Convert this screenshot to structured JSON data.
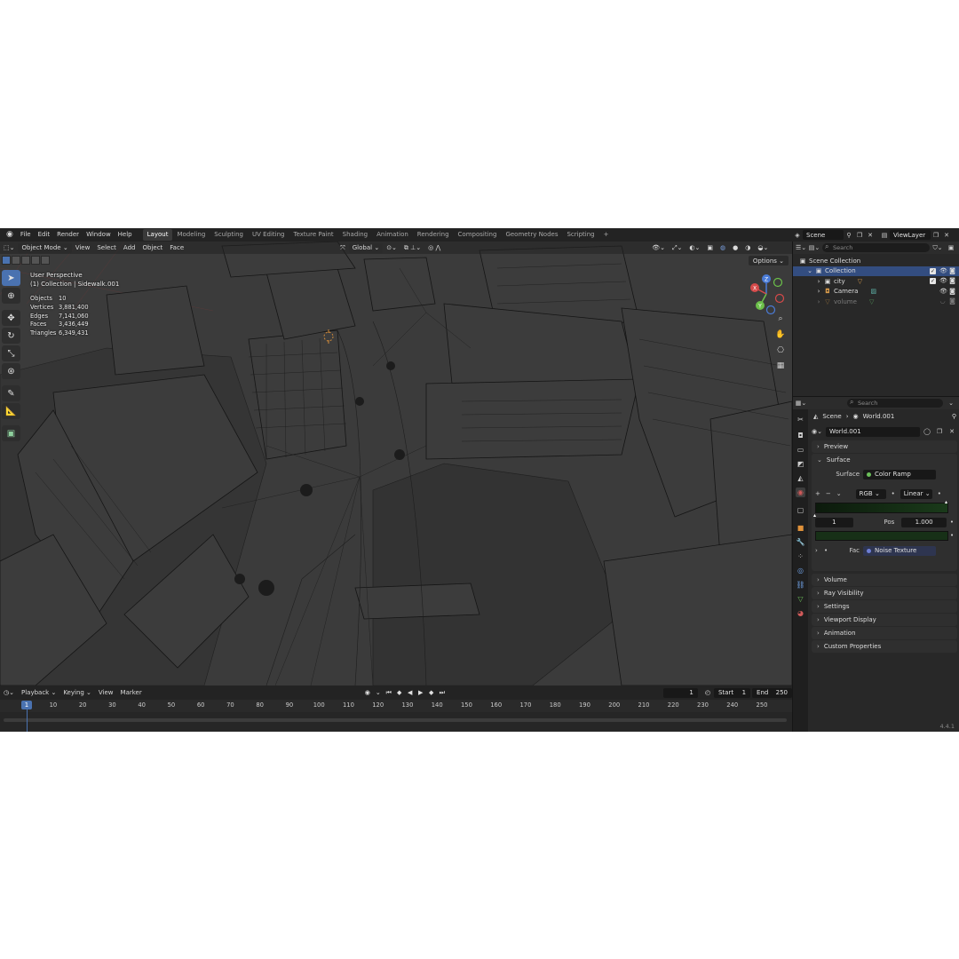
{
  "topbar": {
    "menus": [
      "File",
      "Edit",
      "Render",
      "Window",
      "Help"
    ],
    "workspaces": [
      "Layout",
      "Modeling",
      "Sculpting",
      "UV Editing",
      "Texture Paint",
      "Shading",
      "Animation",
      "Rendering",
      "Compositing",
      "Geometry Nodes",
      "Scripting"
    ],
    "active_workspace": "Layout",
    "add_tab": "+",
    "scene": "Scene",
    "view_layer": "ViewLayer"
  },
  "viewport": {
    "mode": "Object Mode",
    "menus": [
      "View",
      "Select",
      "Add",
      "Object",
      "Face"
    ],
    "transform_orientation": "Global",
    "options": "Options",
    "perspective": "User Perspective",
    "collection_info": "(1) Collection | Sidewalk.001",
    "stats": [
      {
        "label": "Objects",
        "value": "10"
      },
      {
        "label": "Vertices",
        "value": "3,881,400"
      },
      {
        "label": "Edges",
        "value": "7,141,060"
      },
      {
        "label": "Faces",
        "value": "3,436,449"
      },
      {
        "label": "Triangles",
        "value": "6,349,431"
      }
    ],
    "gizmo": {
      "x": "X",
      "y": "Y",
      "z": "Z"
    }
  },
  "timeline": {
    "menus": [
      "Playback",
      "Keying",
      "View",
      "Marker"
    ],
    "current_frame": "1",
    "start_label": "Start",
    "start": "1",
    "end_label": "End",
    "end": "250",
    "ticks": [
      "10",
      "20",
      "30",
      "40",
      "50",
      "60",
      "70",
      "80",
      "90",
      "100",
      "110",
      "120",
      "130",
      "140",
      "150",
      "160",
      "170",
      "180",
      "190",
      "200",
      "210",
      "220",
      "230",
      "240",
      "250"
    ],
    "playhead": "1"
  },
  "outliner": {
    "search_placeholder": "Search",
    "scene_collection": "Scene Collection",
    "collection": "Collection",
    "items": [
      {
        "name": "city"
      },
      {
        "name": "Camera"
      },
      {
        "name": "volume"
      }
    ]
  },
  "properties": {
    "search_placeholder": "Search",
    "breadcrumb_scene": "Scene",
    "breadcrumb_world": "World.001",
    "world_name": "World.001",
    "panels": {
      "preview": "Preview",
      "surface": "Surface",
      "volume": "Volume",
      "ray_visibility": "Ray Visibility",
      "settings": "Settings",
      "viewport_display": "Viewport Display",
      "animation": "Animation",
      "custom_properties": "Custom Properties"
    },
    "surface_label": "Surface",
    "surface_value": "Color Ramp",
    "ramp_mode": "RGB",
    "ramp_interp": "Linear",
    "ramp_index": "1",
    "pos_label": "Pos",
    "pos_value": "1.000",
    "fac_label": "Fac",
    "fac_value": "Noise Texture"
  },
  "status": {
    "version": "4.4.1"
  },
  "colors": {
    "accent": "#4a72b0",
    "selection": "#334d80",
    "shader_socket": "#6bbf59",
    "texture_socket": "#6e7fd6"
  }
}
